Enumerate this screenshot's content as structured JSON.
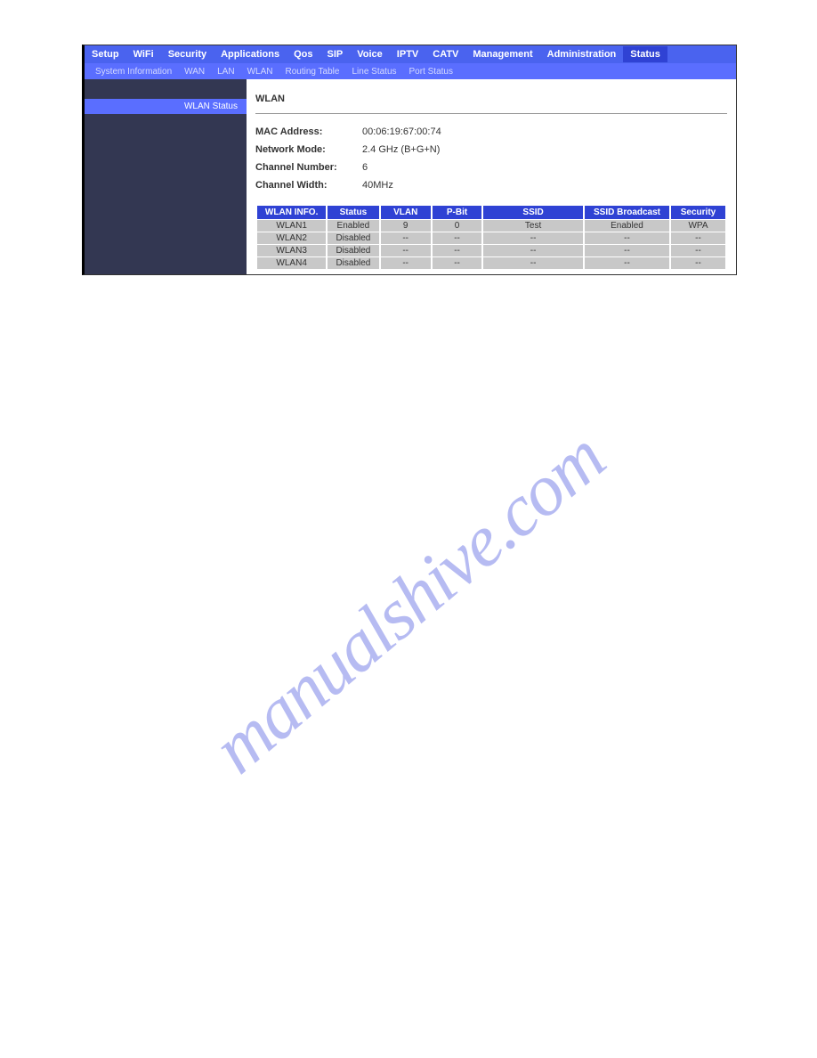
{
  "main_nav": {
    "items": [
      "Setup",
      "WiFi",
      "Security",
      "Applications",
      "Qos",
      "SIP",
      "Voice",
      "IPTV",
      "CATV",
      "Management",
      "Administration",
      "Status"
    ],
    "active": "Status"
  },
  "sub_nav": {
    "items": [
      "System Information",
      "WAN",
      "LAN",
      "WLAN",
      "Routing Table",
      "Line Status",
      "Port Status"
    ]
  },
  "sidebar": {
    "item": "WLAN Status"
  },
  "section": {
    "title": "WLAN"
  },
  "info": {
    "mac_label": "MAC Address:",
    "mac_value": "00:06:19:67:00:74",
    "mode_label": "Network Mode:",
    "mode_value": "2.4 GHz (B+G+N)",
    "channel_label": "Channel Number:",
    "channel_value": "6",
    "width_label": "Channel Width:",
    "width_value": "40MHz"
  },
  "table": {
    "headers": [
      "WLAN INFO.",
      "Status",
      "VLAN",
      "P-Bit",
      "SSID",
      "SSID Broadcast",
      "Security"
    ],
    "rows": [
      {
        "name": "WLAN1",
        "status": "Enabled",
        "vlan": "9",
        "pbit": "0",
        "ssid": "Test",
        "broadcast": "Enabled",
        "security": "WPA"
      },
      {
        "name": "WLAN2",
        "status": "Disabled",
        "vlan": "--",
        "pbit": "--",
        "ssid": "--",
        "broadcast": "--",
        "security": "--"
      },
      {
        "name": "WLAN3",
        "status": "Disabled",
        "vlan": "--",
        "pbit": "--",
        "ssid": "--",
        "broadcast": "--",
        "security": "--"
      },
      {
        "name": "WLAN4",
        "status": "Disabled",
        "vlan": "--",
        "pbit": "--",
        "ssid": "--",
        "broadcast": "--",
        "security": "--"
      }
    ]
  },
  "watermark": "manualshive.com"
}
